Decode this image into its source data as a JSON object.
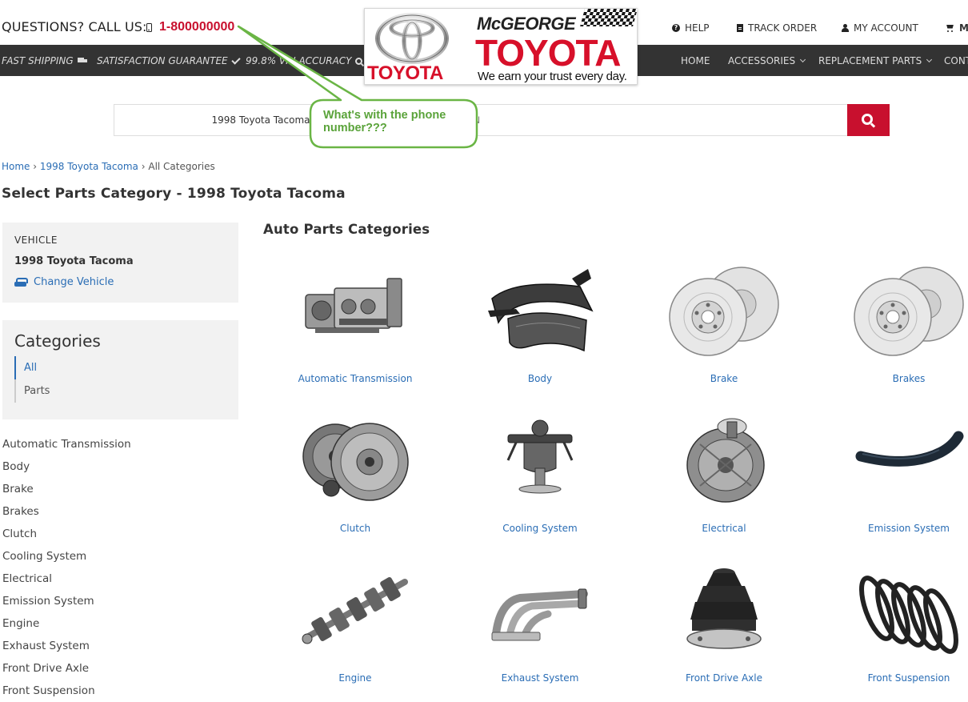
{
  "header": {
    "questions_label": "QUESTIONS? CALL US:",
    "phone_number": "1-800000000",
    "help_label": "HELP",
    "track_order_label": "TRACK ORDER",
    "my_account_label": "MY ACCOUNT",
    "cart_label": "M"
  },
  "promo_bar": {
    "fast_shipping": "FAST SHIPPING",
    "satisfaction": "SATISFACTION GUARANTEE",
    "vin_accuracy": "99.8% VIN ACCURACY"
  },
  "nav": {
    "home": "HOME",
    "accessories": "ACCESSORIES",
    "replacement_parts": "REPLACEMENT PARTS",
    "contact": "CONT"
  },
  "logo": {
    "toyota_word": "TOYOTA",
    "dealer_name": "McGEORGE",
    "brand_big": "TOYOTA",
    "tagline": "We earn your trust every day."
  },
  "search": {
    "vehicle_selected": "1998 Toyota Tacoma",
    "input_placeholder": "IN"
  },
  "callout": {
    "text": "What's with the phone number???"
  },
  "breadcrumb": {
    "home": "Home",
    "vehicle": "1998 Toyota Tacoma",
    "current": "All Categories",
    "separator": "›"
  },
  "page_title": "Select Parts Category - 1998 Toyota Tacoma",
  "vehicle_box": {
    "label": "VEHICLE",
    "name": "1998 Toyota Tacoma",
    "change_label": "Change Vehicle"
  },
  "categories_box": {
    "title": "Categories",
    "items": [
      {
        "label": "All",
        "active": true
      },
      {
        "label": "Parts",
        "active": false
      }
    ]
  },
  "side_list": [
    "Automatic Transmission",
    "Body",
    "Brake",
    "Brakes",
    "Clutch",
    "Cooling System",
    "Electrical",
    "Emission System",
    "Engine",
    "Exhaust System",
    "Front Drive Axle",
    "Front Suspension"
  ],
  "grid": {
    "heading": "Auto Parts Categories",
    "tiles": [
      {
        "label": "Automatic Transmission",
        "icon": "transmission-icon"
      },
      {
        "label": "Body",
        "icon": "body-panel-icon"
      },
      {
        "label": "Brake",
        "icon": "brake-rotor-icon"
      },
      {
        "label": "Brakes",
        "icon": "brake-rotor-icon"
      },
      {
        "label": "Clutch",
        "icon": "clutch-icon"
      },
      {
        "label": "Cooling System",
        "icon": "thermostat-icon"
      },
      {
        "label": "Electrical",
        "icon": "alternator-icon"
      },
      {
        "label": "Emission System",
        "icon": "hose-icon"
      },
      {
        "label": "Engine",
        "icon": "crankshaft-icon"
      },
      {
        "label": "Exhaust System",
        "icon": "exhaust-header-icon"
      },
      {
        "label": "Front Drive Axle",
        "icon": "cv-boot-icon"
      },
      {
        "label": "Front Suspension",
        "icon": "coil-spring-icon"
      }
    ]
  },
  "colors": {
    "accent_red": "#c8102e",
    "link_blue": "#2a6db5",
    "nav_bg": "#333333",
    "callout_green": "#5aa33a"
  }
}
